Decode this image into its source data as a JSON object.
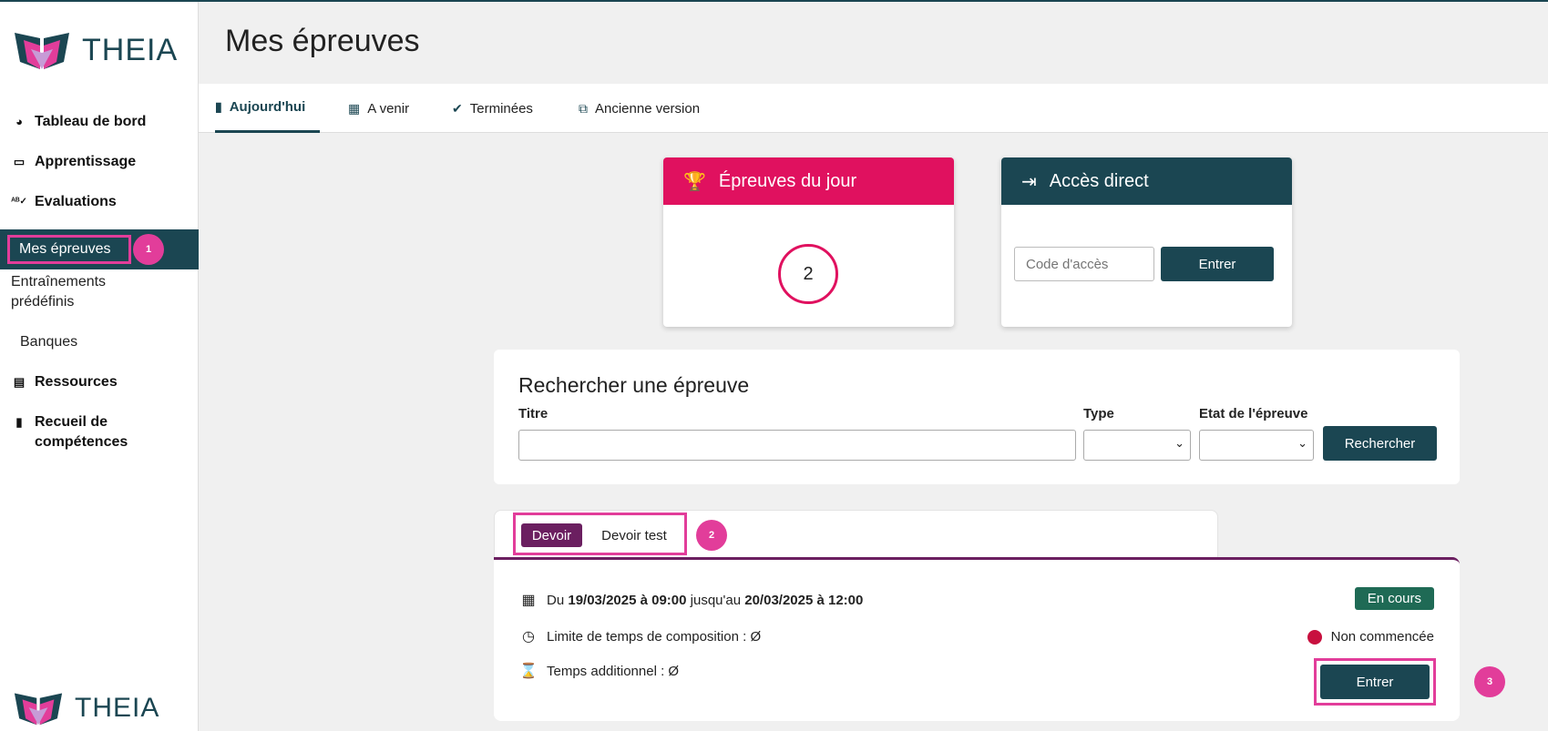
{
  "app": {
    "brand": "THEIA"
  },
  "sidebar": {
    "items": [
      {
        "icon": "palette-icon",
        "label": "Tableau de bord"
      },
      {
        "icon": "presentation-icon",
        "label": "Apprentissage"
      },
      {
        "icon": "spellcheck-icon",
        "label": "Evaluations"
      }
    ],
    "sub_items": [
      {
        "label": "Mes épreuves",
        "active": true,
        "annotation": "1"
      },
      {
        "label": "Entraînements prédéfinis"
      },
      {
        "label": "Banques"
      }
    ],
    "items2": [
      {
        "icon": "book-icon",
        "label": "Ressources"
      },
      {
        "icon": "clipboard-icon",
        "label": "Recueil de compétences"
      }
    ]
  },
  "header": {
    "title": "Mes épreuves"
  },
  "tabs": [
    {
      "label": "Aujourd'hui",
      "icon": "clipboard-icon",
      "active": true
    },
    {
      "label": "A venir",
      "icon": "calendar-clock-icon"
    },
    {
      "label": "Terminées",
      "icon": "check-badge-icon"
    },
    {
      "label": "Ancienne version",
      "icon": "external-link-icon"
    }
  ],
  "daily_card": {
    "title": "Épreuves du jour",
    "count": "2"
  },
  "access_card": {
    "title": "Accès direct",
    "placeholder": "Code d'accès",
    "button": "Entrer"
  },
  "search": {
    "title": "Rechercher une épreuve",
    "title_label": "Titre",
    "type_label": "Type",
    "state_label": "Etat de l'épreuve",
    "button": "Rechercher"
  },
  "result_tabs": {
    "active": "Devoir",
    "other": "Devoir test",
    "annotation": "2"
  },
  "result": {
    "date_prefix": "Du",
    "date_start": "19/03/2025 à 09:00",
    "date_mid": "jusqu'au",
    "date_end": "20/03/2025 à 12:00",
    "time_limit": "Limite de temps de composition : Ø",
    "extra_time": "Temps additionnel : Ø",
    "status": "En cours",
    "state": "Non commencée",
    "button": "Entrer",
    "annotation": "3"
  },
  "colors": {
    "primary": "#1b4652",
    "accent": "#e0115f",
    "highlight": "#e23d9a",
    "tab_active": "#6b1f60",
    "status": "#1f6a55"
  }
}
